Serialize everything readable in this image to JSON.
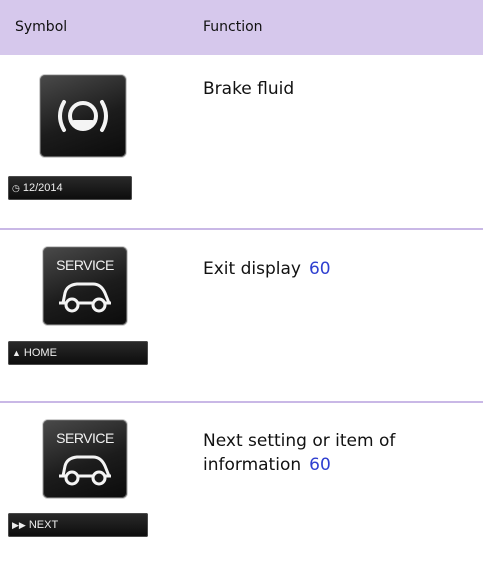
{
  "header": {
    "symbol": "Symbol",
    "function": "Function"
  },
  "rows": [
    {
      "icon": "brake-fluid-warning-icon",
      "strip_icon": "clock-icon",
      "strip_text": "12/2014",
      "function": "Brake fluid",
      "page": ""
    },
    {
      "icon": "service-car-icon",
      "icon_label": "SERVICE",
      "strip_icon": "arrow-up-icon",
      "strip_text": "HOME",
      "function": "Exit display",
      "page": "60"
    },
    {
      "icon": "service-car-icon",
      "icon_label": "SERVICE",
      "strip_icon": "fast-forward-icon",
      "strip_text": "NEXT",
      "function_line1": "Next setting or item of",
      "function_line2": "information",
      "page": "60"
    }
  ],
  "colors": {
    "header_bg": "#d6c8ec",
    "divider": "#c9b8e6",
    "link": "#2f3fd0"
  }
}
